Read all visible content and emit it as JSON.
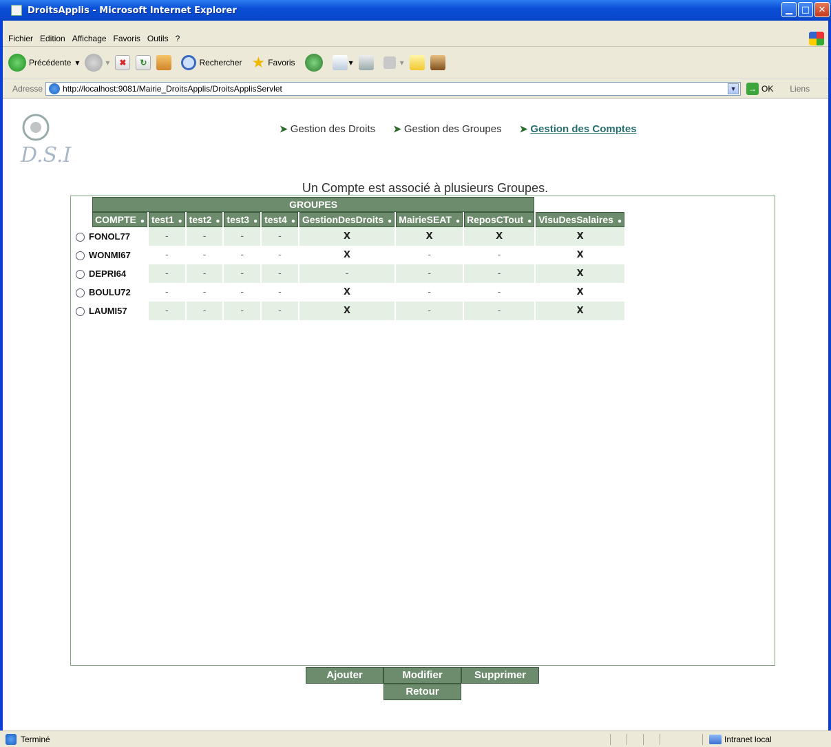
{
  "window": {
    "title": "DroitsApplis - Microsoft Internet Explorer",
    "controls": [
      "minimize",
      "maximize",
      "close"
    ]
  },
  "menubar": {
    "items": [
      "Fichier",
      "Edition",
      "Affichage",
      "Favoris",
      "Outils",
      "?"
    ]
  },
  "toolbar": {
    "back_label": "Précédente",
    "search_label": "Rechercher",
    "favorites_label": "Favoris"
  },
  "address": {
    "label": "Adresse",
    "url": "http://localhost:9081/Mairie_DroitsApplis/DroitsApplisServlet",
    "go_label": "OK",
    "links_label": "Liens"
  },
  "nav": {
    "items": [
      {
        "label": "Gestion des Droits",
        "active": false
      },
      {
        "label": "Gestion des Groupes",
        "active": false
      },
      {
        "label": "Gestion des Comptes",
        "active": true
      }
    ]
  },
  "page": {
    "subtitle": "Un Compte est associé à plusieurs Groupes.",
    "groups_header": "GROUPES",
    "account_header": "COMPTE",
    "columns": [
      "test1",
      "test2",
      "test3",
      "test4",
      "GestionDesDroits",
      "MairieSEAT",
      "ReposCTout",
      "VisuDesSalaires"
    ],
    "rows": [
      {
        "account": "FONOL77",
        "values": [
          "-",
          "-",
          "-",
          "-",
          "X",
          "X",
          "X",
          "X"
        ]
      },
      {
        "account": "WONMI67",
        "values": [
          "-",
          "-",
          "-",
          "-",
          "X",
          "-",
          "-",
          "X"
        ]
      },
      {
        "account": "DEPRI64",
        "values": [
          "-",
          "-",
          "-",
          "-",
          "-",
          "-",
          "-",
          "X"
        ]
      },
      {
        "account": "BOULU72",
        "values": [
          "-",
          "-",
          "-",
          "-",
          "X",
          "-",
          "-",
          "X"
        ]
      },
      {
        "account": "LAUMI57",
        "values": [
          "-",
          "-",
          "-",
          "-",
          "X",
          "-",
          "-",
          "X"
        ]
      }
    ]
  },
  "buttons": {
    "add": "Ajouter",
    "modify": "Modifier",
    "delete": "Supprimer",
    "back": "Retour"
  },
  "statusbar": {
    "status": "Terminé",
    "zone": "Intranet local"
  },
  "colors": {
    "header_green": "#6d8c6d",
    "row_alt": "#e3f0e3",
    "title_blue": "#0a4fd6"
  }
}
